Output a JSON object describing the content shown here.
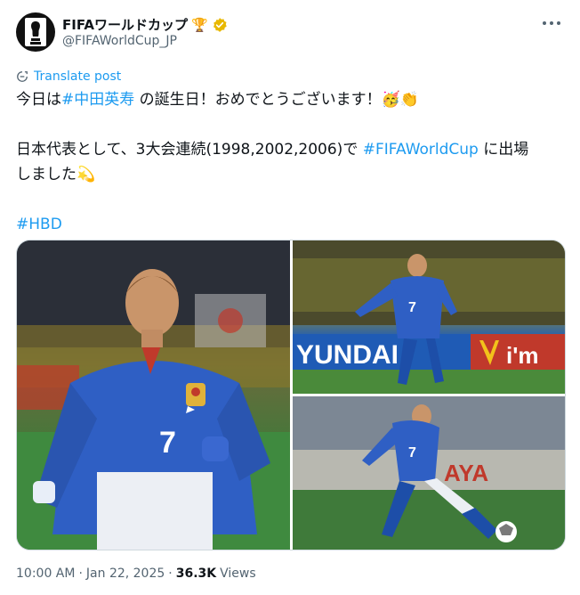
{
  "account": {
    "display_name": "FIFAワールドカップ",
    "handle": "@FIFAWorldCup_JP",
    "avatar_icon": "fifa-trophy-logo",
    "badge_emoji": "🏆",
    "verified_color": "#e8b800"
  },
  "post": {
    "translate_label": "Translate post",
    "line1_before": "今日は",
    "line1_hashtag": "#中田英寿",
    "line1_after": " の誕生日！おめでとうございます！🥳👏",
    "line2_before": "日本代表として、3大会連続(1998,2002,2006)で ",
    "line2_hashtag": "#FIFAWorldCup",
    "line2_after": " に出場",
    "line3": "しました💫",
    "line4_hashtag": "#HBD"
  },
  "media": {
    "photos": [
      {
        "alt": "player-in-japan-kit-running"
      },
      {
        "alt": "player-kicking-ball-stadium"
      },
      {
        "alt": "player-passing-ball"
      }
    ],
    "shirt_number": "7",
    "board_text_1": "YUNDAI",
    "board_text_2": "i'm",
    "board_text_3": "AYA"
  },
  "meta": {
    "time": "10:00 AM",
    "date": "Jan 22, 2025",
    "views_count": "36.3K",
    "views_label": "Views"
  },
  "colors": {
    "accent": "#1d9bf0",
    "text": "#0f1419",
    "muted": "#536471"
  }
}
